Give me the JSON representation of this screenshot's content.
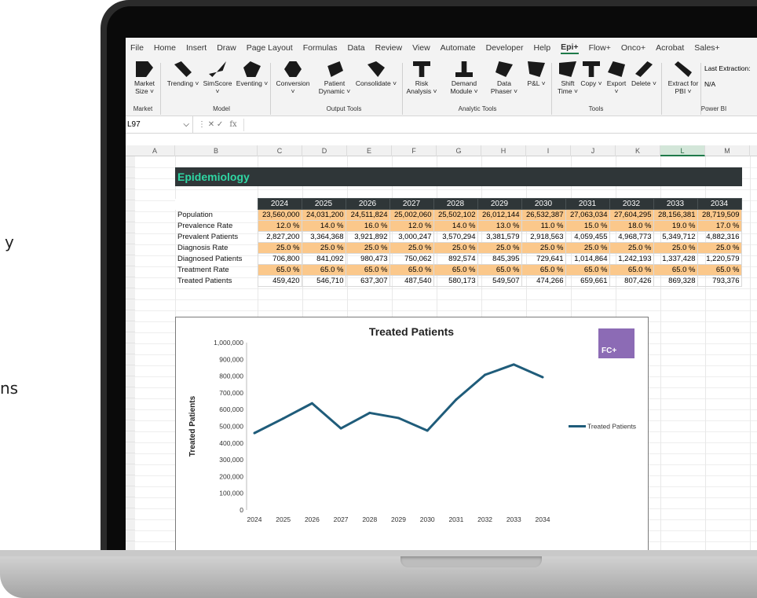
{
  "side_text": [
    "y",
    "ns"
  ],
  "menu": [
    "File",
    "Home",
    "Insert",
    "Draw",
    "Page Layout",
    "Formulas",
    "Data",
    "Review",
    "View",
    "Automate",
    "Developer",
    "Help",
    "Epi+",
    "Flow+",
    "Onco+",
    "Acrobat",
    "Sales+"
  ],
  "menu_active": "Epi+",
  "ribbon": {
    "buttons": [
      {
        "label": "Market Size ˅"
      },
      {
        "label": "Trending ˅"
      },
      {
        "label": "SimScore ˅"
      },
      {
        "label": "Eventing ˅"
      },
      {
        "label": "Conversion ˅"
      },
      {
        "label": "Patient Dynamic ˅"
      },
      {
        "label": "Consolidate ˅"
      },
      {
        "label": "Risk Analysis ˅"
      },
      {
        "label": "Demand Module ˅"
      },
      {
        "label": "Data Phaser ˅"
      },
      {
        "label": "P&L ˅"
      },
      {
        "label": "Shift Time ˅"
      },
      {
        "label": "Copy ˅"
      },
      {
        "label": "Export ˅"
      },
      {
        "label": "Delete ˅"
      },
      {
        "label": "Extract for PBI ˅"
      }
    ],
    "groups": [
      "Market",
      "Model",
      "Output Tools",
      "Analytic Tools",
      "Tools",
      "Power BI"
    ],
    "last_extraction_label": "Last Extraction:",
    "last_extraction_value": "N/A"
  },
  "formula_bar": {
    "cell_ref": "L97",
    "fx": "fx",
    "value": ""
  },
  "columns": [
    "A",
    "B",
    "C",
    "D",
    "E",
    "F",
    "G",
    "H",
    "I",
    "J",
    "K",
    "L",
    "M"
  ],
  "selected_column": "L",
  "sheet": {
    "section_title": "Epidemiology",
    "years": [
      "2024",
      "2025",
      "2026",
      "2027",
      "2028",
      "2029",
      "2030",
      "2031",
      "2032",
      "2033",
      "2034"
    ],
    "rows": [
      {
        "label": "Population",
        "orange": true,
        "values": [
          "23,560,000",
          "24,031,200",
          "24,511,824",
          "25,002,060",
          "25,502,102",
          "26,012,144",
          "26,532,387",
          "27,063,034",
          "27,604,295",
          "28,156,381",
          "28,719,509"
        ]
      },
      {
        "label": "Prevalence Rate",
        "orange": true,
        "values": [
          "12.0 %",
          "14.0 %",
          "16.0 %",
          "12.0 %",
          "14.0 %",
          "13.0 %",
          "11.0 %",
          "15.0 %",
          "18.0 %",
          "19.0 %",
          "17.0 %"
        ]
      },
      {
        "label": "Prevalent Patients",
        "orange": false,
        "values": [
          "2,827,200",
          "3,364,368",
          "3,921,892",
          "3,000,247",
          "3,570,294",
          "3,381,579",
          "2,918,563",
          "4,059,455",
          "4,968,773",
          "5,349,712",
          "4,882,316"
        ]
      },
      {
        "label": "Diagnosis Rate",
        "orange": true,
        "values": [
          "25.0 %",
          "25.0 %",
          "25.0 %",
          "25.0 %",
          "25.0 %",
          "25.0 %",
          "25.0 %",
          "25.0 %",
          "25.0 %",
          "25.0 %",
          "25.0 %"
        ]
      },
      {
        "label": "Diagnosed Patients",
        "orange": false,
        "values": [
          "706,800",
          "841,092",
          "980,473",
          "750,062",
          "892,574",
          "845,395",
          "729,641",
          "1,014,864",
          "1,242,193",
          "1,337,428",
          "1,220,579"
        ]
      },
      {
        "label": "Treatment Rate",
        "orange": true,
        "values": [
          "65.0 %",
          "65.0 %",
          "65.0 %",
          "65.0 %",
          "65.0 %",
          "65.0 %",
          "65.0 %",
          "65.0 %",
          "65.0 %",
          "65.0 %",
          "65.0 %"
        ]
      },
      {
        "label": "Treated Patients",
        "orange": false,
        "values": [
          "459,420",
          "546,710",
          "637,307",
          "487,540",
          "580,173",
          "549,507",
          "474,266",
          "659,661",
          "807,426",
          "869,328",
          "793,376"
        ]
      }
    ]
  },
  "logo_text": "FC+",
  "chart_data": {
    "type": "line",
    "title": "Treated Patients",
    "xlabel": "",
    "ylabel": "Treated Patients",
    "categories": [
      "2024",
      "2025",
      "2026",
      "2027",
      "2028",
      "2029",
      "2030",
      "2031",
      "2032",
      "2033",
      "2034"
    ],
    "series": [
      {
        "name": "Treated Patients",
        "color": "#1f5c7a",
        "values": [
          459420,
          546710,
          637307,
          487540,
          580173,
          549507,
          474266,
          659661,
          807426,
          869328,
          793376
        ]
      }
    ],
    "ylim": [
      0,
      1000000
    ],
    "yticks": [
      "0",
      "100,000",
      "200,000",
      "300,000",
      "400,000",
      "500,000",
      "600,000",
      "700,000",
      "800,000",
      "900,000",
      "1,000,000"
    ],
    "legend": "right",
    "grid": false
  }
}
